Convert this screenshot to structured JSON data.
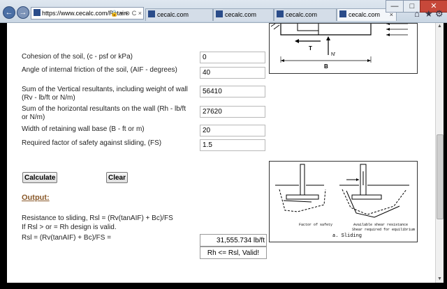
{
  "browser": {
    "url": "https://www.cecalc.com/Retain",
    "tabs": [
      {
        "label": "cecalc.com",
        "active": false
      },
      {
        "label": "cecalc.com",
        "active": false
      },
      {
        "label": "cecalc.com",
        "active": false
      },
      {
        "label": "cecalc.com",
        "active": true
      }
    ],
    "back_glyph": "←",
    "forward_glyph": "→",
    "tab_close_glyph": "×",
    "minimize_glyph": "—",
    "maximize_glyph": "□",
    "close_glyph": "✕",
    "home_glyph": "⌂",
    "favorites_glyph": "★",
    "tools_glyph": "⚙",
    "address_tools": "🔒 ▾ ⊗ C ×"
  },
  "form": {
    "inputs": [
      {
        "label": "Cohesion of the soil, (c - psf or kPa)",
        "value": "0"
      },
      {
        "label": "Angle of internal friction of the soil, (AIF - degrees)",
        "value": "40"
      },
      {
        "label": "Sum of the Vertical resultants, including weight of wall (Rv - lb/ft or N/m)",
        "value": "56410"
      },
      {
        "label": "Sum of the horizontal resultants on the wall (Rh - lb/ft or N/m)",
        "value": "27620"
      },
      {
        "label": "Width of retaining wall base (B - ft or m)",
        "value": "20"
      },
      {
        "label": "Required factor of safety against sliding, (FS)",
        "value": "1.5"
      }
    ],
    "calculate_label": "Calculate",
    "clear_label": "Clear"
  },
  "output": {
    "heading": "Output:",
    "line1": "Resistance to sliding, Rsl = (Rv(tanAIF) + Bc)/FS",
    "line2": "If Rsl > or = Rh design is valid.",
    "line3": "Rsl = (Rv(tanAIF) + Bc)/FS =",
    "result": "31,555.734 lb/ft",
    "validity": "Rh <= Rsl, Valid!"
  },
  "figure_top": {
    "label_t": "T",
    "label_n": "N'",
    "label_b": "B"
  },
  "figure_bottom": {
    "caption": "a. Sliding",
    "label_factor": "Factor of safety",
    "label_shear": "Available shear resistance",
    "label_required": "Shear required for equilibrium"
  }
}
